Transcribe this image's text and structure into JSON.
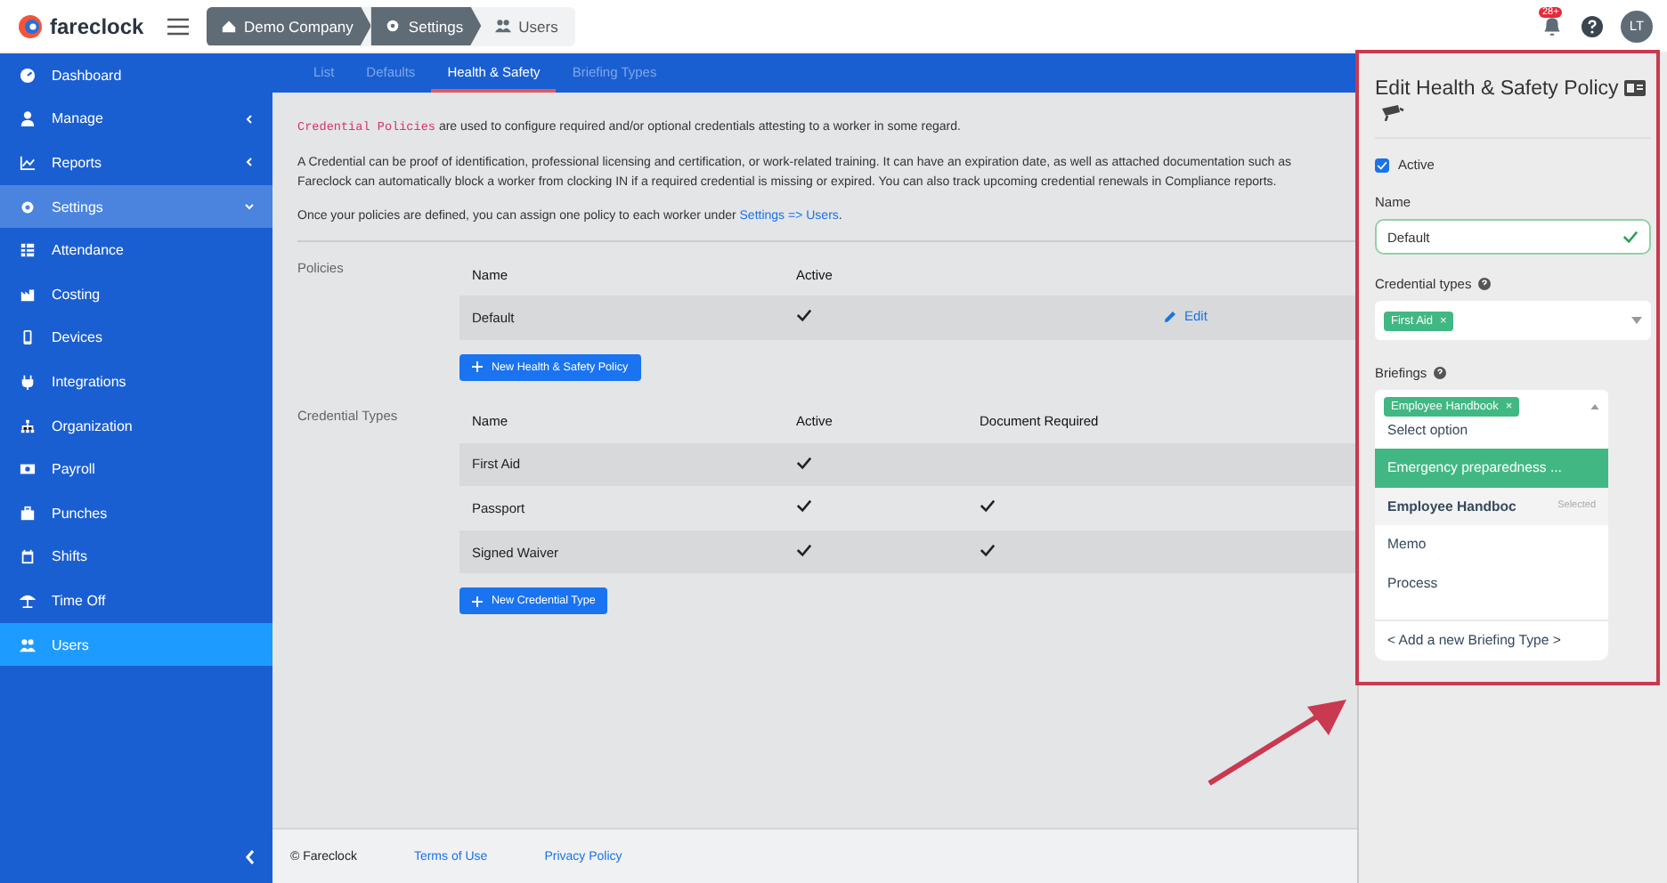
{
  "brand": {
    "name": "fareclock"
  },
  "breadcrumbs": [
    {
      "label": "Demo Company"
    },
    {
      "label": "Settings"
    },
    {
      "label": "Users"
    }
  ],
  "notifications": {
    "badge": "28+"
  },
  "user": {
    "initials": "LT"
  },
  "sidebar": {
    "items": [
      {
        "label": "Dashboard",
        "kind": "link",
        "selected": false
      },
      {
        "label": "Manage",
        "kind": "group",
        "expanded": false,
        "selected": false
      },
      {
        "label": "Reports",
        "kind": "group",
        "expanded": false,
        "selected": false
      },
      {
        "label": "Settings",
        "kind": "group",
        "expanded": true,
        "selected": false
      },
      {
        "label": "Attendance",
        "kind": "link",
        "selected": false
      },
      {
        "label": "Costing",
        "kind": "link",
        "selected": false
      },
      {
        "label": "Devices",
        "kind": "link",
        "selected": false
      },
      {
        "label": "Integrations",
        "kind": "link",
        "selected": false
      },
      {
        "label": "Organization",
        "kind": "link",
        "selected": false
      },
      {
        "label": "Payroll",
        "kind": "link",
        "selected": false
      },
      {
        "label": "Punches",
        "kind": "link",
        "selected": false
      },
      {
        "label": "Shifts",
        "kind": "link",
        "selected": false
      },
      {
        "label": "Time Off",
        "kind": "link",
        "selected": false
      },
      {
        "label": "Users",
        "kind": "link",
        "selected": true
      }
    ]
  },
  "tabs": [
    {
      "label": "List",
      "selected": false
    },
    {
      "label": "Defaults",
      "selected": false
    },
    {
      "label": "Health & Safety",
      "selected": true
    },
    {
      "label": "Briefing Types",
      "selected": false
    }
  ],
  "intro": {
    "code": "Credential Policies",
    "text": " are used to configure required and/or optional credentials attesting to a worker in some regard.",
    "paragraph_2": "A Credential can be proof of identification, professional licensing and certification, or work-related training. It can have an expiration date, as well as attached documentation such as",
    "paragraph_3": "Fareclock can automatically block a worker from clocking IN if a required credential is missing or expired. You can also track upcoming credential renewals in Compliance reports.",
    "paragraph_4": "Once your policies are defined, you can assign one policy to each worker under ",
    "link": "Settings => Users",
    "end": "."
  },
  "policies": {
    "title": "Policies",
    "columns": [
      "Name",
      "Active"
    ],
    "rows": [
      {
        "name": "Default",
        "active": true,
        "action": "Edit"
      }
    ],
    "button": "New Health & Safety Policy"
  },
  "credential_types": {
    "title": "Credential Types",
    "columns": [
      "Name",
      "Active",
      "Document Required"
    ],
    "rows": [
      {
        "name": "First Aid",
        "active": true,
        "document_required": false
      },
      {
        "name": "Passport",
        "active": true,
        "document_required": true
      },
      {
        "name": "Signed Waiver",
        "active": true,
        "document_required": true
      }
    ],
    "button": "New Credential Type"
  },
  "panel": {
    "title": "Edit Health & Safety Policy",
    "active": {
      "label": "Active",
      "checked": true
    },
    "name": {
      "label": "Name",
      "value": "Default",
      "valid": true
    },
    "credential_types": {
      "label": "Credential types",
      "tags": [
        {
          "label": "First Aid",
          "remove": "×"
        }
      ]
    },
    "briefings": {
      "label": "Briefings",
      "tags": [
        {
          "label": "Employee Handbook",
          "remove": "×"
        }
      ],
      "expanded": true,
      "placeholder": "Select option",
      "options": [
        {
          "label": "Emergency preparedness ...",
          "highlighted": true,
          "selected": false
        },
        {
          "label": "Employee Handboc",
          "highlighted": false,
          "selected": true,
          "note": "Selected"
        },
        {
          "label": "Memo",
          "highlighted": false,
          "selected": false
        },
        {
          "label": "Process",
          "highlighted": false,
          "selected": false
        }
      ],
      "add": "< Add a new Briefing Type >"
    }
  },
  "footer": {
    "copyright": "© Fareclock",
    "links": [
      "Terms of Use",
      "Privacy Policy"
    ]
  }
}
